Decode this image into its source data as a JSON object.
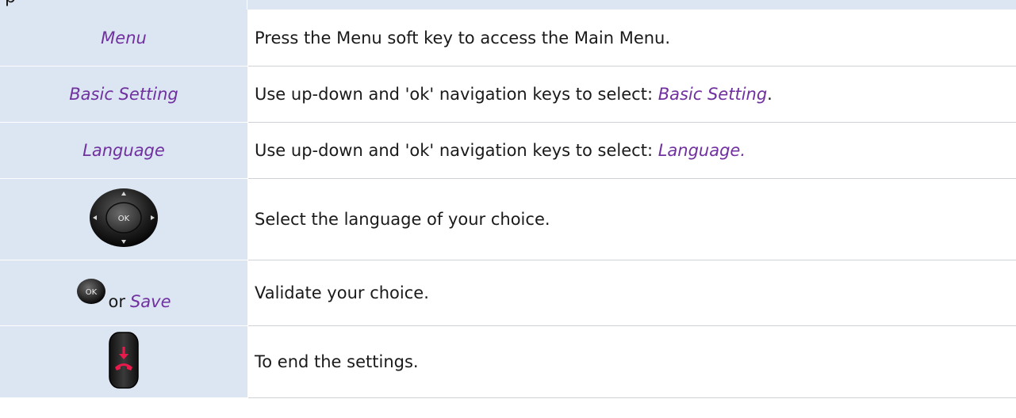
{
  "header": {
    "fragment": "p"
  },
  "rows": [
    {
      "key_label": "Menu",
      "description": "Press the Menu soft key to access the Main Menu."
    },
    {
      "key_label": "Basic Setting",
      "description_prefix": "Use up-down and 'ok' navigation keys to select: ",
      "description_emph": "Basic Setting",
      "description_suffix": "."
    },
    {
      "key_label": "Language",
      "description_prefix": "Use up-down and 'ok' navigation keys to select: ",
      "description_emph": "Language."
    },
    {
      "key_icon": "navigation-pad-icon",
      "key_icon_text": "OK",
      "description": "Select the language of your choice."
    },
    {
      "key_icon": "ok-button-icon",
      "key_icon_text": "OK",
      "key_or": "or",
      "key_label": "Save",
      "description": "Validate your choice."
    },
    {
      "key_icon": "end-call-key-icon",
      "description": "To end the settings."
    }
  ],
  "colors": {
    "key_column_bg": "#dce6f2",
    "keyword": "#7030a0",
    "end_icon": "#e8194b"
  }
}
